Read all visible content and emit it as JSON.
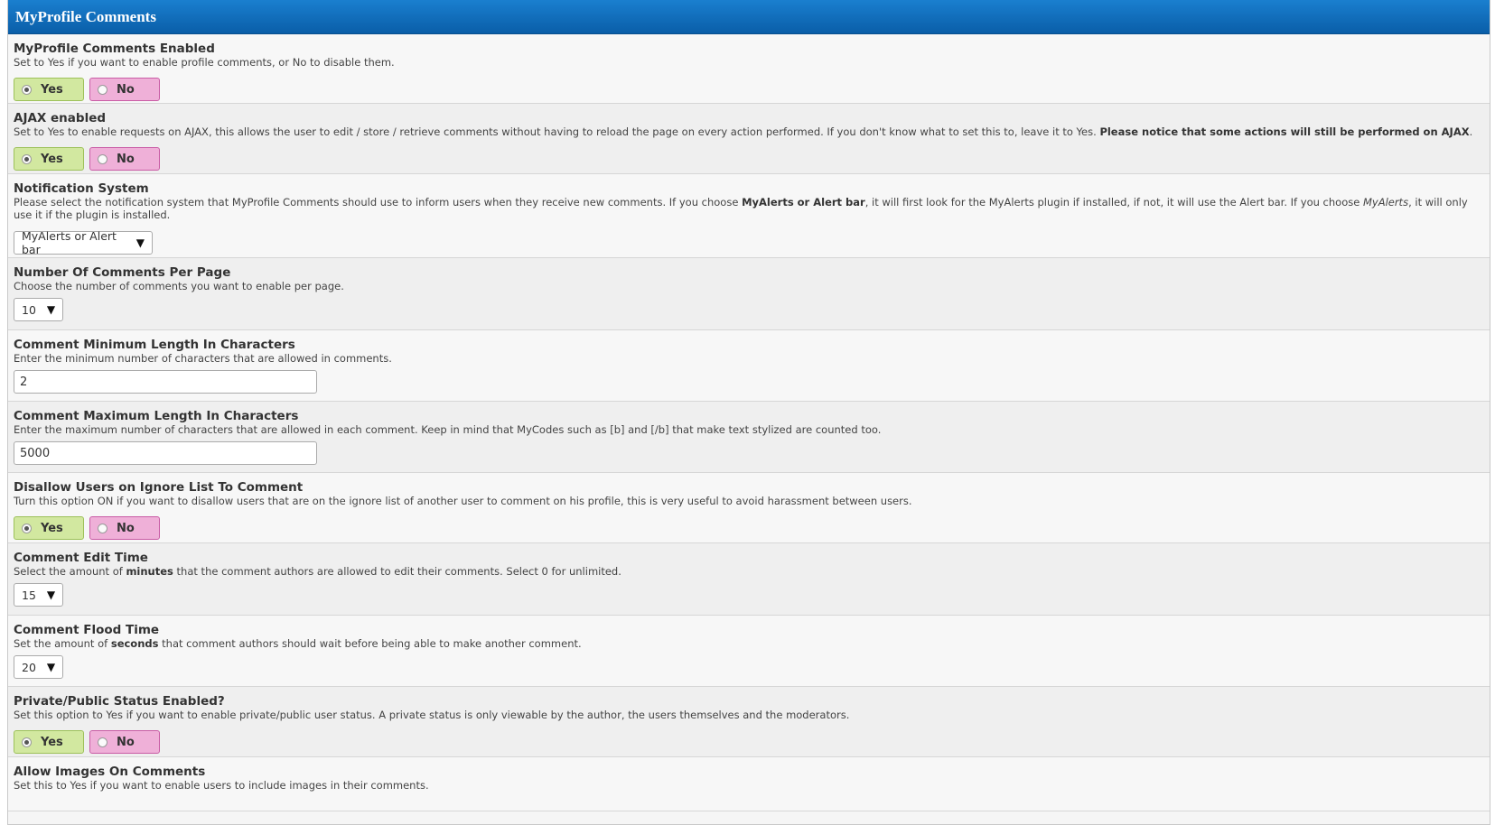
{
  "header": {
    "title": "MyProfile Comments"
  },
  "common": {
    "yes_label": "Yes",
    "no_label": "No"
  },
  "settings": {
    "enabled": {
      "title": "MyProfile Comments Enabled",
      "desc": "Set to Yes if you want to enable profile comments, or No to disable them.",
      "value": "Yes"
    },
    "ajax": {
      "title": "AJAX enabled",
      "desc": "Set to Yes to enable requests on AJAX, this allows the user to edit / store / retrieve comments without having to reload the page on every action performed. If you don't know what to set this to, leave it to Yes.",
      "desc_bold": "Please notice that some actions will still be performed on AJAX",
      "desc_end": ".",
      "value": "Yes"
    },
    "notification": {
      "title": "Notification System",
      "desc_1": "Please select the notification system that MyProfile Comments should use to inform users when they receive new comments. If you choose",
      "desc_bold": "MyAlerts or Alert bar",
      "desc_2": ", it will first look for the MyAlerts plugin if installed, if not, it will use the Alert bar. If you choose",
      "desc_italic": "MyAlerts",
      "desc_3": ", it will only use it if the plugin is installed.",
      "value": "MyAlerts or Alert bar"
    },
    "per_page": {
      "title": "Number Of Comments Per Page",
      "desc": "Choose the number of comments you want to enable per page.",
      "value": "10"
    },
    "min_length": {
      "title": "Comment Minimum Length In Characters",
      "desc": "Enter the minimum number of characters that are allowed in comments.",
      "value": "2"
    },
    "max_length": {
      "title": "Comment Maximum Length In Characters",
      "desc": "Enter the maximum number of characters that are allowed in each comment. Keep in mind that MyCodes such as [b] and [/b] that make text stylized are counted too.",
      "value": "5000"
    },
    "ignore_list": {
      "title": "Disallow Users on Ignore List To Comment",
      "desc": "Turn this option ON if you want to disallow users that are on the ignore list of another user to comment on his profile, this is very useful to avoid harassment between users.",
      "value": "Yes"
    },
    "edit_time": {
      "title": "Comment Edit Time",
      "desc_1": "Select the amount of",
      "desc_bold": "minutes",
      "desc_2": "that the comment authors are allowed to edit their comments. Select 0 for unlimited.",
      "value": "15"
    },
    "flood_time": {
      "title": "Comment Flood Time",
      "desc_1": "Set the amount of",
      "desc_bold": "seconds",
      "desc_2": "that comment authors should wait before being able to make another comment.",
      "value": "20"
    },
    "private_status": {
      "title": "Private/Public Status Enabled?",
      "desc": "Set this option to Yes if you want to enable private/public user status. A private status is only viewable by the author, the users themselves and the moderators.",
      "value": "Yes"
    },
    "images": {
      "title": "Allow Images On Comments",
      "desc": "Set this to Yes if you want to enable users to include images in their comments."
    }
  }
}
